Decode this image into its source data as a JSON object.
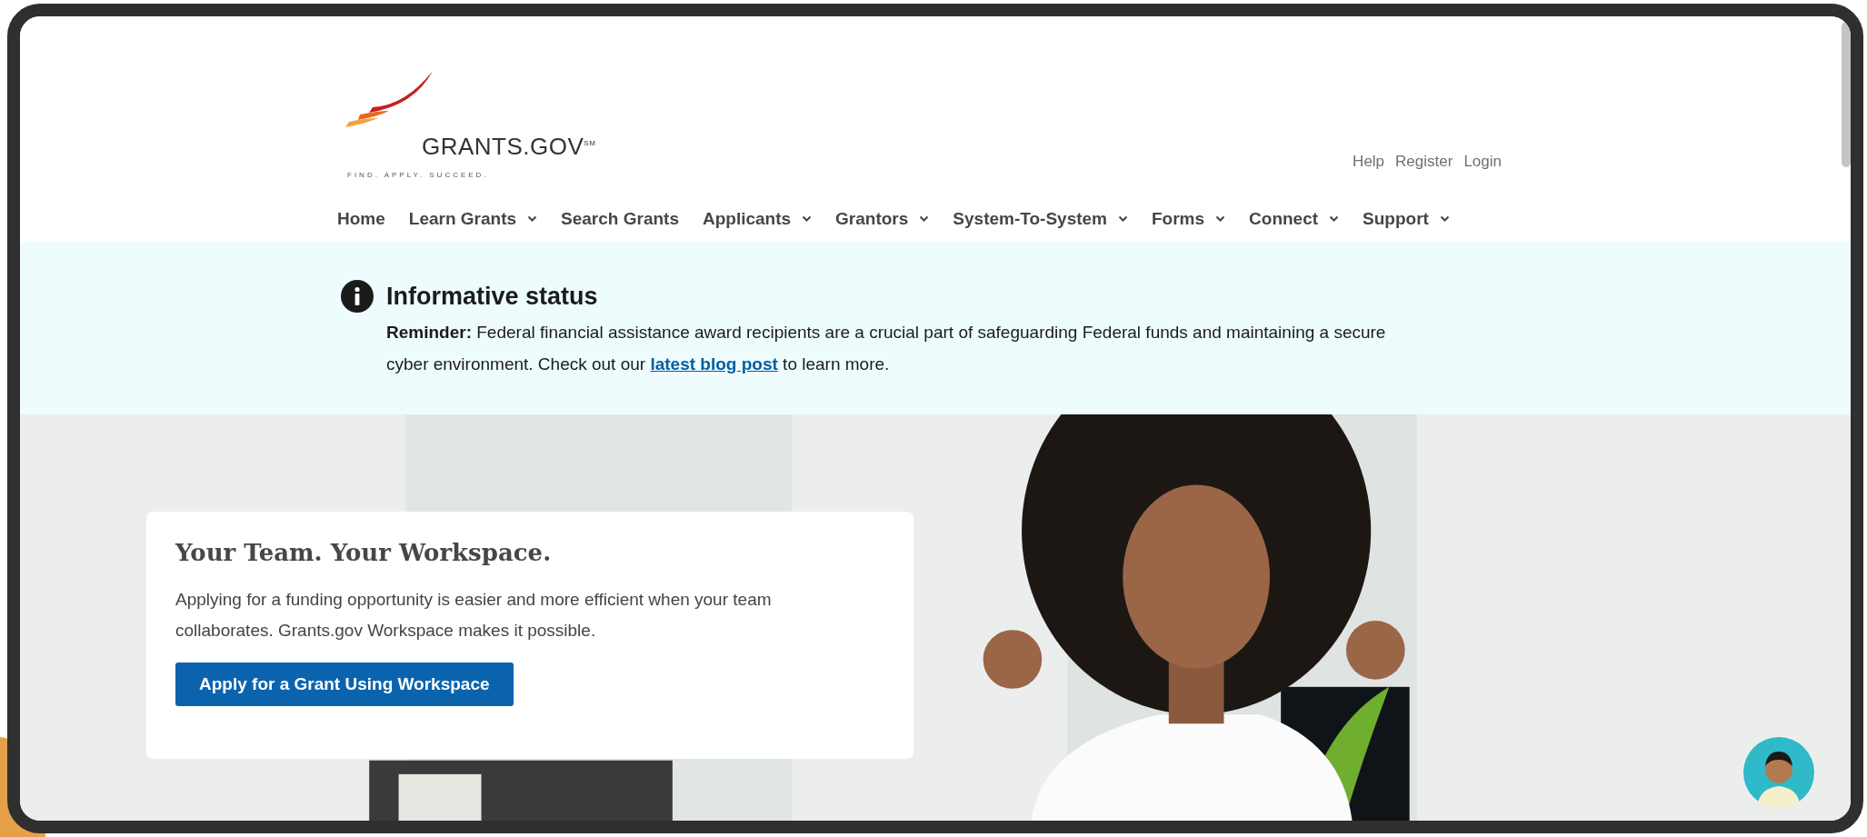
{
  "logo": {
    "name": "GRANTS.GOV$^{SM}$",
    "tagline": "FIND. APPLY. SUCCEED."
  },
  "utility_links": [
    "Help",
    "Register",
    "Login"
  ],
  "nav": [
    {
      "label": "Home",
      "has_menu": false
    },
    {
      "label": "Learn Grants",
      "has_menu": true
    },
    {
      "label": "Search Grants",
      "has_menu": false
    },
    {
      "label": "Applicants",
      "has_menu": true
    },
    {
      "label": "Grantors",
      "has_menu": true
    },
    {
      "label": "System-To-System",
      "has_menu": true
    },
    {
      "label": "Forms",
      "has_menu": true
    },
    {
      "label": "Connect",
      "has_menu": true
    },
    {
      "label": "Support",
      "has_menu": true
    }
  ],
  "alert": {
    "kind": "info",
    "title": "Informative status",
    "message": "**Reminder:** Federal financial assistance award recipients are a crucial part of safeguarding Federal funds and maintaining a secure cyber environment. Check out our",
    "link": "latest blog post",
    "message_end": "to learn more."
  },
  "hero": {
    "kind": "picture",
    "card": {
      "title": "Your Team. Your Workspace.",
      "text": "Applying for a funding opportunity is easier and more efficient when your team collaborates. Grants.gov Workspace makes it possible.",
      "button": "Apply for a Grant Using Workspace"
    }
  }
}
